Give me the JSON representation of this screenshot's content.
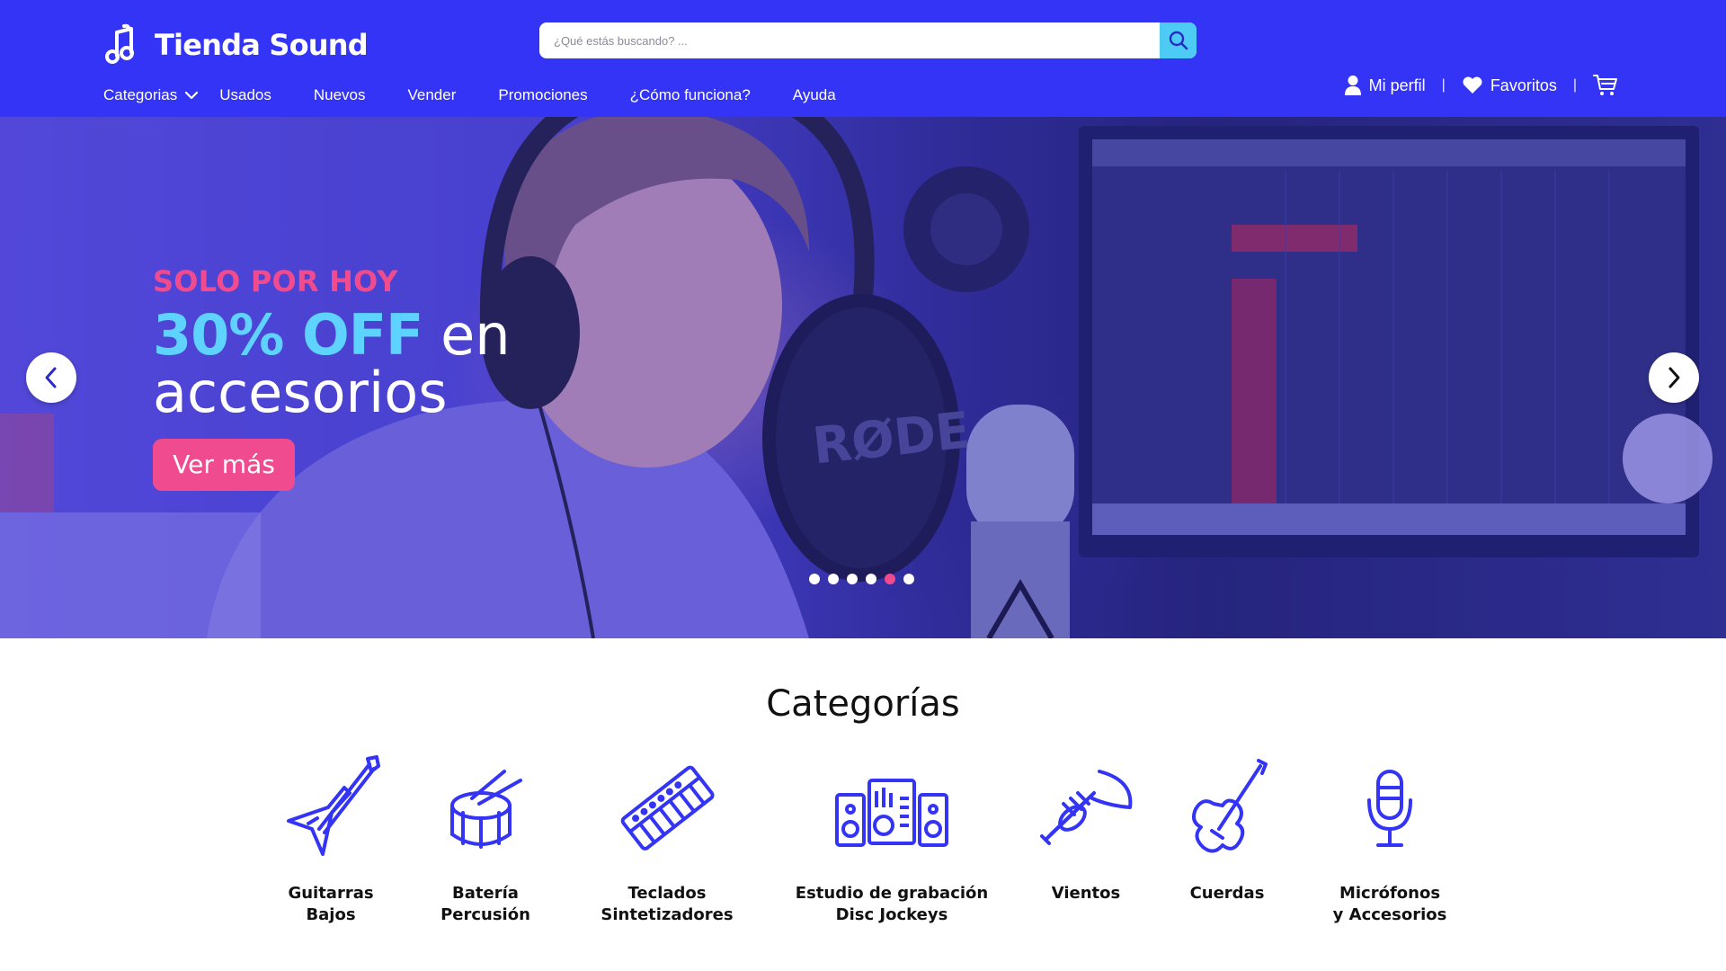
{
  "brand": {
    "name": "Tienda Sound",
    "primary_color": "#3434f6",
    "accent_pink": "#ef4b8e",
    "accent_cyan": "#5fd3ff"
  },
  "search": {
    "placeholder": "¿Qué estás buscando? ...",
    "value": "",
    "icon": "search-icon"
  },
  "nav": {
    "items": [
      {
        "label": "Categorias",
        "icon": "chevron-down-icon"
      },
      {
        "label": "Usados"
      },
      {
        "label": "Nuevos"
      },
      {
        "label": "Vender"
      },
      {
        "label": "Promociones"
      },
      {
        "label": "¿Cómo funciona?"
      },
      {
        "label": "Ayuda"
      }
    ]
  },
  "user_links": {
    "profile": {
      "label": "Mi perfil",
      "icon": "user-icon"
    },
    "favorites": {
      "label": "Favoritos",
      "icon": "heart-icon"
    },
    "cart": {
      "icon": "cart-icon"
    },
    "separator": "|"
  },
  "hero": {
    "eyebrow": "SOLO POR HOY",
    "highlight": "30% OFF",
    "line1_rest": " en",
    "line2": "accesorios",
    "cta": "Ver más",
    "slides_count": 6,
    "active_slide": 5,
    "prev_icon": "chevron-left-icon",
    "next_icon": "chevron-right-icon"
  },
  "categories": {
    "title": "Categorías",
    "items": [
      {
        "line1": "Guitarras",
        "line2": "Bajos",
        "icon": "guitar-icon"
      },
      {
        "line1": "Batería",
        "line2": "Percusión",
        "icon": "drum-icon"
      },
      {
        "line1": "Teclados",
        "line2": "Sintetizadores",
        "icon": "keyboard-icon"
      },
      {
        "line1": "Estudio de grabación",
        "line2": "Disc Jockeys",
        "icon": "studio-speakers-icon"
      },
      {
        "line1": "Vientos",
        "line2": "",
        "icon": "trumpet-icon"
      },
      {
        "line1": "Cuerdas",
        "line2": "",
        "icon": "violin-icon"
      },
      {
        "line1": "Micrófonos",
        "line2": "y Accesorios",
        "icon": "microphone-icon"
      }
    ]
  }
}
